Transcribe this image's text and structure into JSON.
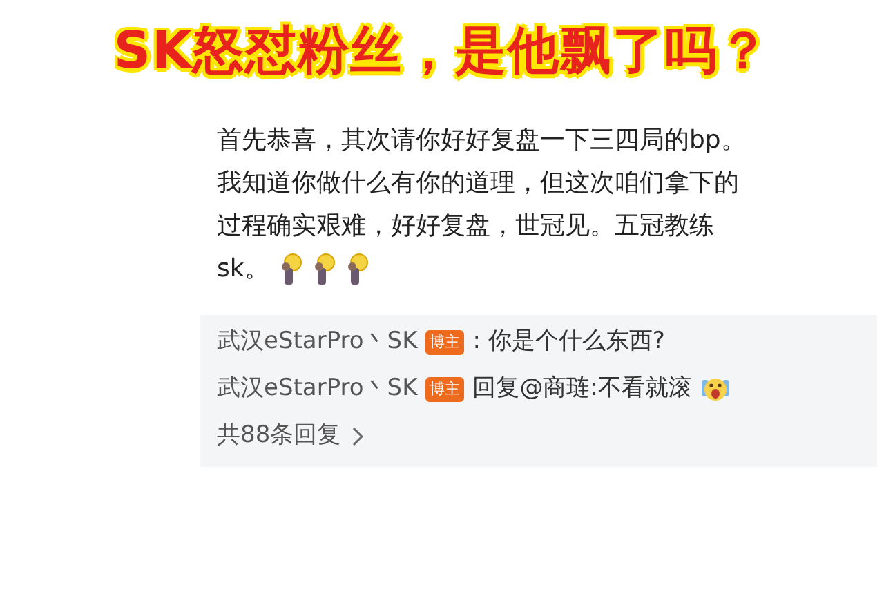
{
  "headline": "SK怒怼粉丝，是他飘了吗？",
  "comment": {
    "lines": [
      "首先恭喜，其次请你好好复盘一下三四局的bp。",
      "我知道你做什么有你的道理，但这次咱们拿下的",
      "过程确实艰难，好好复盘，世冠见。五冠教练",
      "sk。"
    ]
  },
  "replies": [
    {
      "author": "武汉eStarPro丶SK",
      "badge": "博主",
      "text": ": 你是个什么东西?"
    },
    {
      "author": "武汉eStarPro丶SK",
      "badge": "博主",
      "text": "回复@商琏:不看就滚"
    }
  ],
  "more_replies": "共88条回复"
}
